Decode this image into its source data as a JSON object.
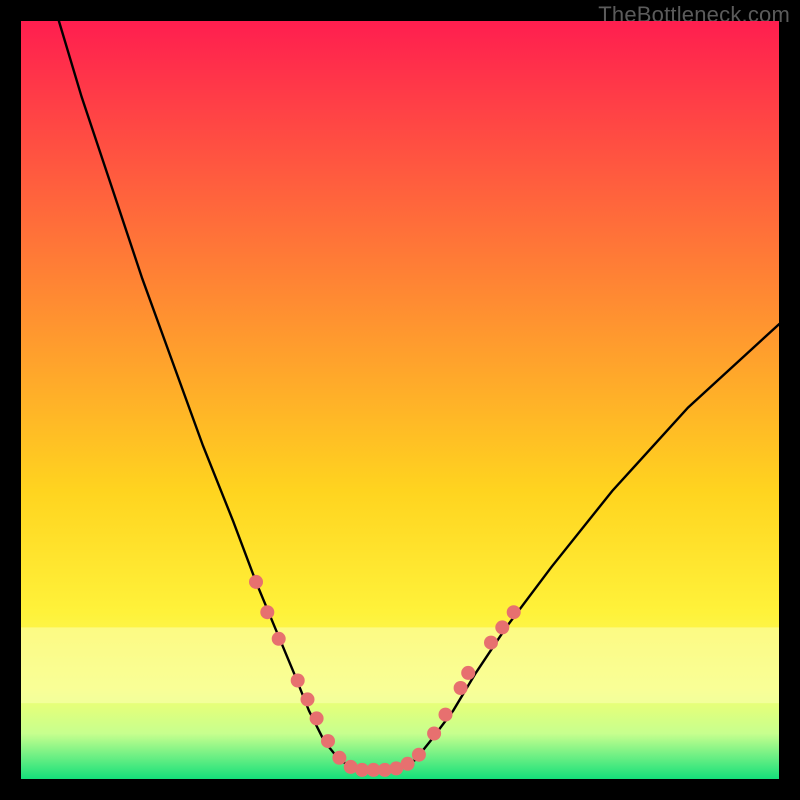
{
  "watermark": "TheBottleneck.com",
  "chart_data": {
    "type": "line",
    "title": "",
    "xlabel": "",
    "ylabel": "",
    "xlim": [
      0,
      100
    ],
    "ylim": [
      0,
      100
    ],
    "grid": false,
    "legend": false,
    "background_gradient": {
      "stops": [
        {
          "offset": 0.0,
          "color": "#ff1e4f"
        },
        {
          "offset": 0.2,
          "color": "#ff5a3f"
        },
        {
          "offset": 0.42,
          "color": "#ff9a2e"
        },
        {
          "offset": 0.62,
          "color": "#ffd41f"
        },
        {
          "offset": 0.78,
          "color": "#fff23a"
        },
        {
          "offset": 0.88,
          "color": "#f6ff6e"
        },
        {
          "offset": 0.94,
          "color": "#c7ff8e"
        },
        {
          "offset": 1.0,
          "color": "#14e07a"
        }
      ]
    },
    "pale_band": {
      "y_top": 80,
      "y_bottom": 90,
      "color": "#fcffb8",
      "opacity": 0.55
    },
    "series": [
      {
        "name": "bottleneck-curve",
        "color": "#000000",
        "stroke_width": 2.4,
        "x": [
          5,
          8,
          12,
          16,
          20,
          24,
          28,
          31,
          33.5,
          36,
          38,
          40,
          42,
          44,
          46,
          48,
          50,
          52,
          54,
          57,
          60,
          64,
          70,
          78,
          88,
          100
        ],
        "y": [
          100,
          90,
          78,
          66,
          55,
          44,
          34,
          26,
          20,
          14,
          9,
          5,
          2.5,
          1.4,
          1.2,
          1.2,
          1.4,
          2.5,
          5,
          9,
          14,
          20,
          28,
          38,
          49,
          60
        ]
      }
    ],
    "markers": {
      "name": "curve-markers",
      "color": "#e7706f",
      "radius": 7,
      "points": [
        {
          "x": 31.0,
          "y": 26
        },
        {
          "x": 32.5,
          "y": 22
        },
        {
          "x": 34.0,
          "y": 18.5
        },
        {
          "x": 36.5,
          "y": 13
        },
        {
          "x": 37.8,
          "y": 10.5
        },
        {
          "x": 39.0,
          "y": 8
        },
        {
          "x": 40.5,
          "y": 5
        },
        {
          "x": 42.0,
          "y": 2.8
        },
        {
          "x": 43.5,
          "y": 1.6
        },
        {
          "x": 45.0,
          "y": 1.2
        },
        {
          "x": 46.5,
          "y": 1.2
        },
        {
          "x": 48.0,
          "y": 1.2
        },
        {
          "x": 49.5,
          "y": 1.4
        },
        {
          "x": 51.0,
          "y": 2.0
        },
        {
          "x": 52.5,
          "y": 3.2
        },
        {
          "x": 54.5,
          "y": 6
        },
        {
          "x": 56.0,
          "y": 8.5
        },
        {
          "x": 58.0,
          "y": 12
        },
        {
          "x": 59.0,
          "y": 14
        },
        {
          "x": 62.0,
          "y": 18
        },
        {
          "x": 63.5,
          "y": 20
        },
        {
          "x": 65.0,
          "y": 22
        }
      ]
    }
  }
}
